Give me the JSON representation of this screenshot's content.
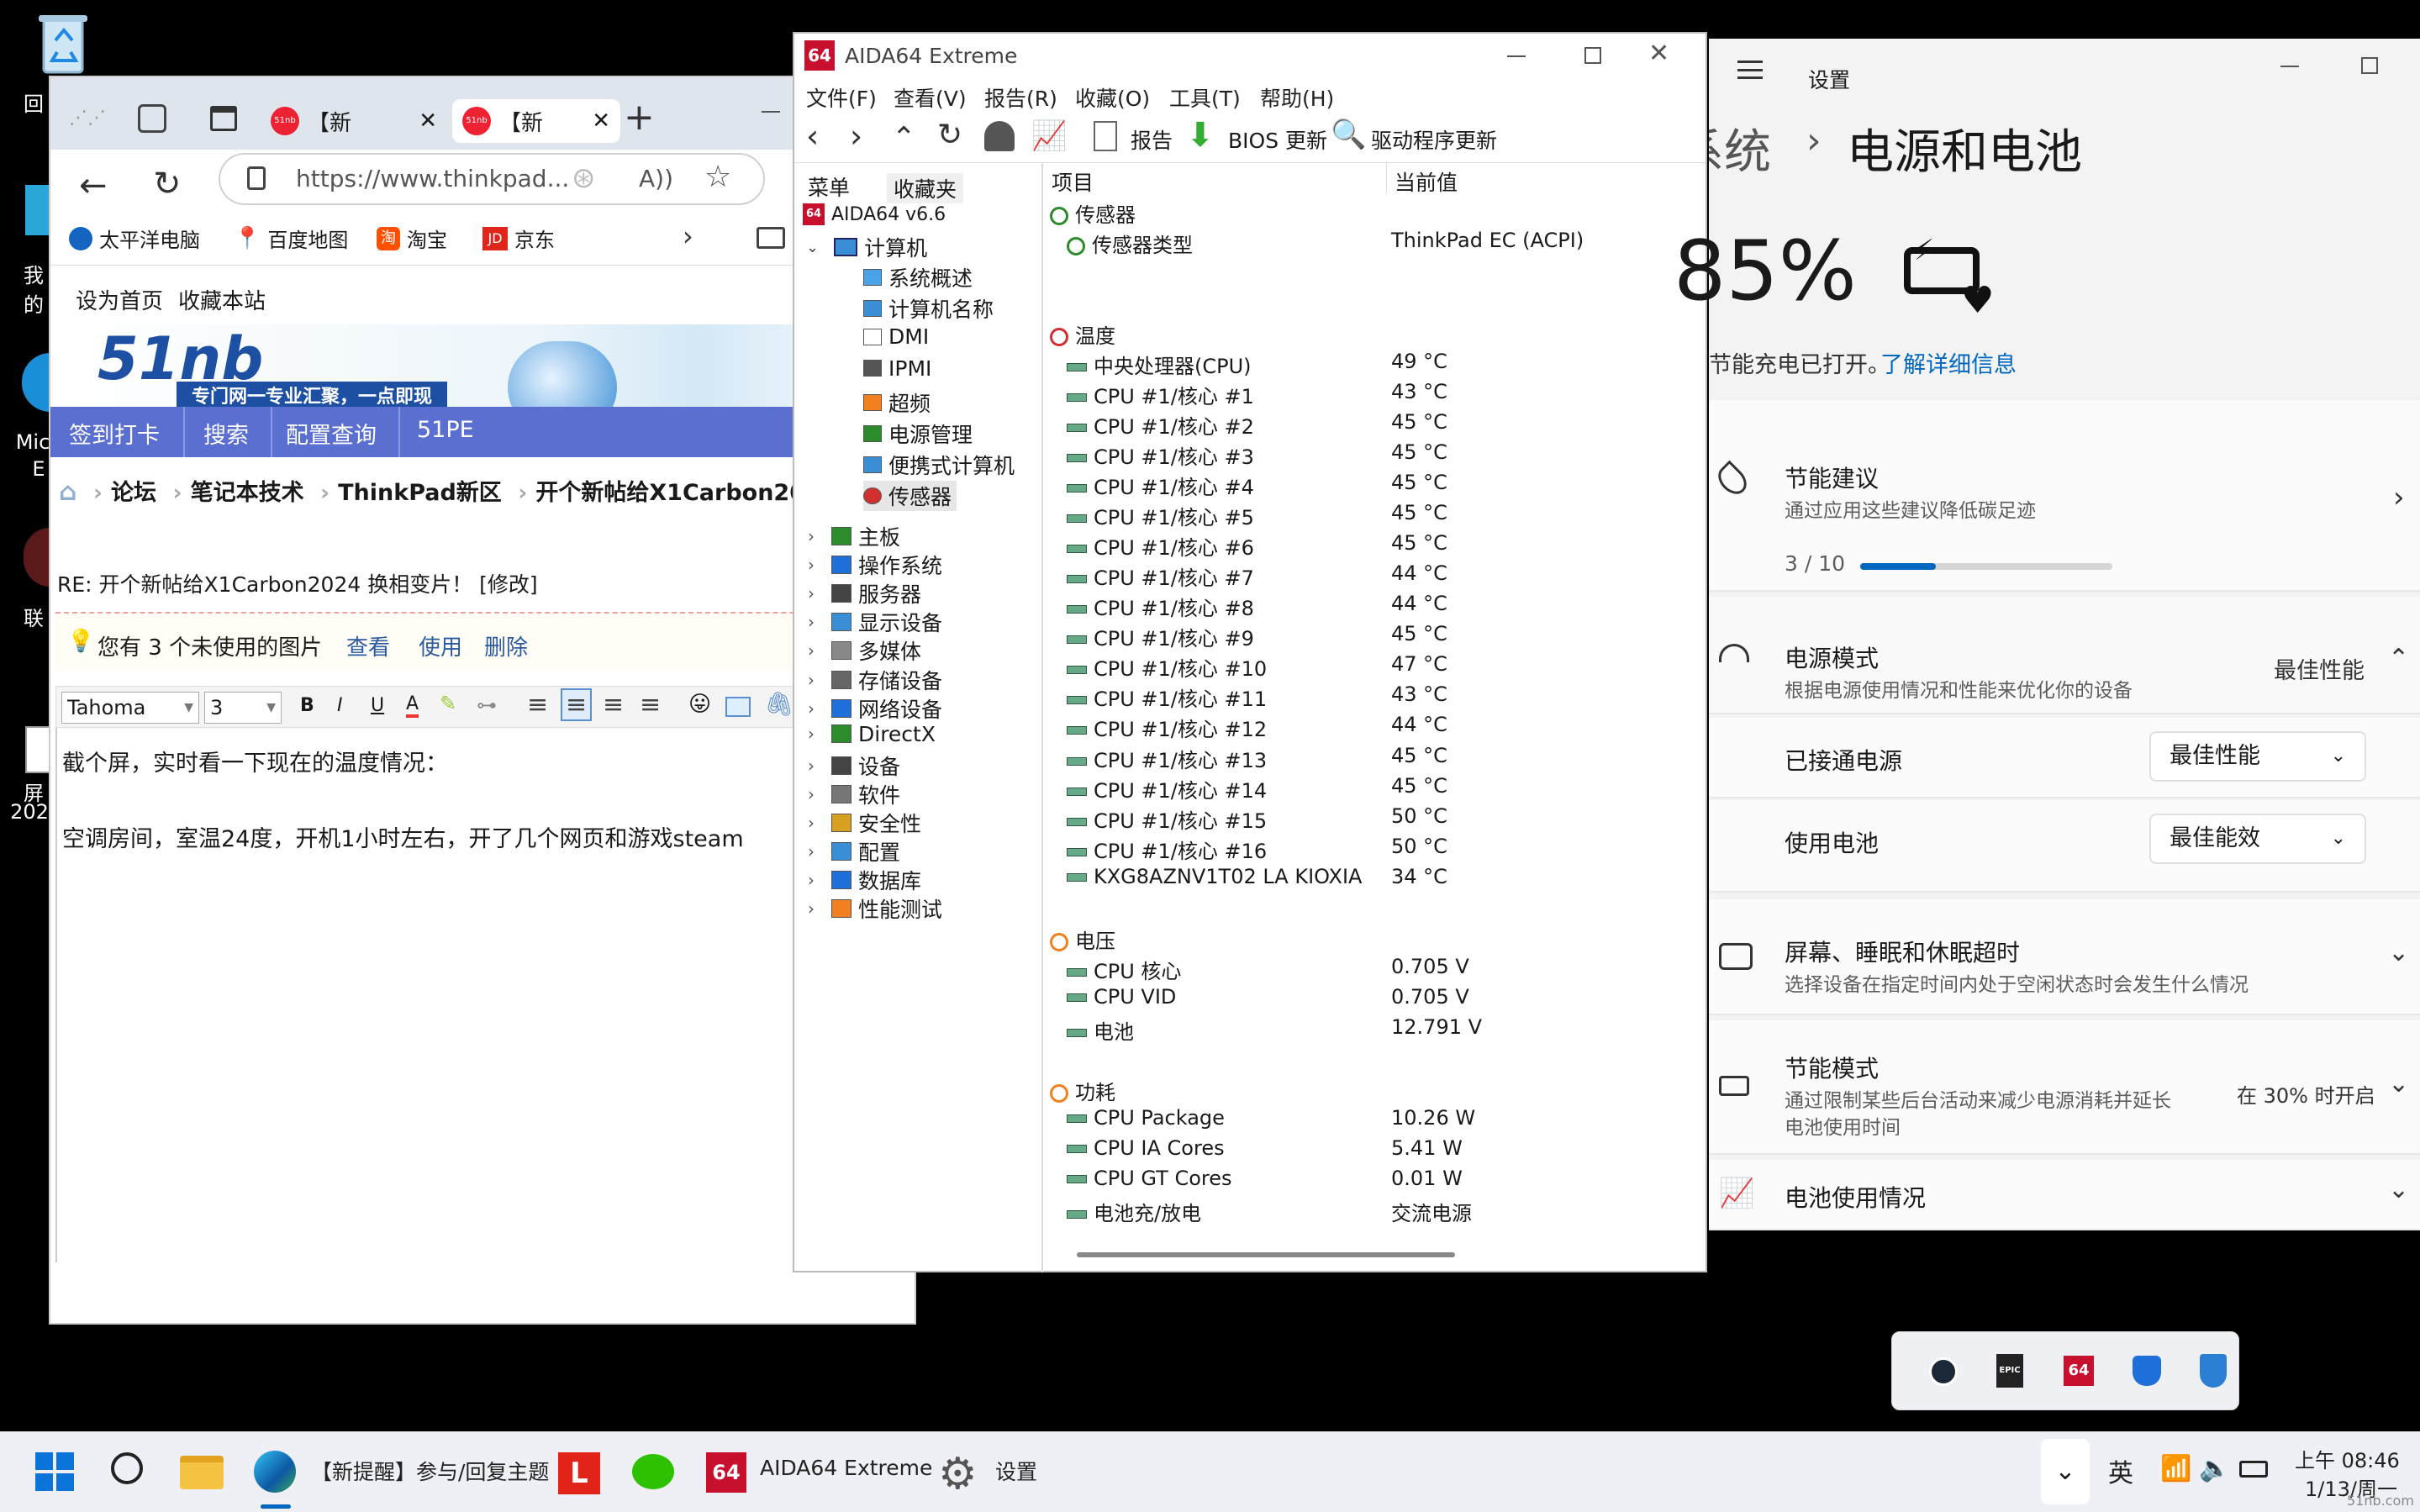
{
  "desktop": {
    "icon1": "回",
    "icon2": "我的",
    "icon3": "Mic",
    "icon3b": "E",
    "icon4": "联",
    "icon5": "屏",
    "icon5b": "202"
  },
  "browser": {
    "tabs": [
      {
        "badge": "51nb",
        "label": "【新"
      },
      {
        "badge": "51nb",
        "label": "【新"
      }
    ],
    "url": "https://www.thinkpad...",
    "favorites": [
      "太平洋电脑",
      "百度地图",
      "淘宝",
      "京东"
    ],
    "top_links": [
      "设为首页",
      "收藏本站"
    ],
    "logo_text": "51nb",
    "banner_slogan": "专门网一专业汇聚，一点即现",
    "nav": [
      "签到打卡",
      "搜索",
      "配置查询",
      "51PE"
    ],
    "breadcrumb": [
      "论坛",
      "笔记本技术",
      "ThinkPad新区",
      "开个新帖给X1Carbon20"
    ],
    "post_title": "RE: 开个新帖给X1Carbon2024 换相变片！ [修改]",
    "unused_notice": "您有 3 个未使用的图片",
    "notice_links": [
      "查看",
      "使用",
      "删除"
    ],
    "font_name": "Tahoma",
    "font_size": "3",
    "editor_line1": "截个屏，实时看一下现在的温度情况：",
    "editor_line2": "空调房间，室温24度，开机1小时左右，开了几个网页和游戏steam"
  },
  "aida": {
    "title": "AIDA64 Extreme",
    "logo": "64",
    "menu": [
      "文件(F)",
      "查看(V)",
      "报告(R)",
      "收藏(O)",
      "工具(T)",
      "帮助(H)"
    ],
    "toolbar": {
      "report": "报告",
      "bios": "BIOS 更新",
      "driver": "驱动程序更新"
    },
    "left_tabs": [
      "菜单",
      "收藏夹"
    ],
    "tree_root": "AIDA64 v6.6",
    "tree_computer": "计算机",
    "tree_children": [
      "系统概述",
      "计算机名称",
      "DMI",
      "IPMI",
      "超频",
      "电源管理",
      "便携式计算机",
      "传感器"
    ],
    "tree_top": [
      "主板",
      "操作系统",
      "服务器",
      "显示设备",
      "多媒体",
      "存储设备",
      "网络设备",
      "DirectX",
      "设备",
      "软件",
      "安全性",
      "配置",
      "数据库",
      "性能测试"
    ],
    "col_item": "项目",
    "col_value": "当前值",
    "sec_sensor": "传感器",
    "sensor_type_k": "传感器类型",
    "sensor_type_v": "ThinkPad EC  (ACPI)",
    "sec_temp": "温度",
    "temps": [
      [
        "中央处理器(CPU)",
        "49 °C"
      ],
      [
        "CPU #1/核心 #1",
        "43 °C"
      ],
      [
        "CPU #1/核心 #2",
        "45 °C"
      ],
      [
        "CPU #1/核心 #3",
        "45 °C"
      ],
      [
        "CPU #1/核心 #4",
        "45 °C"
      ],
      [
        "CPU #1/核心 #5",
        "45 °C"
      ],
      [
        "CPU #1/核心 #6",
        "45 °C"
      ],
      [
        "CPU #1/核心 #7",
        "44 °C"
      ],
      [
        "CPU #1/核心 #8",
        "44 °C"
      ],
      [
        "CPU #1/核心 #9",
        "45 °C"
      ],
      [
        "CPU #1/核心 #10",
        "47 °C"
      ],
      [
        "CPU #1/核心 #11",
        "43 °C"
      ],
      [
        "CPU #1/核心 #12",
        "44 °C"
      ],
      [
        "CPU #1/核心 #13",
        "45 °C"
      ],
      [
        "CPU #1/核心 #14",
        "45 °C"
      ],
      [
        "CPU #1/核心 #15",
        "50 °C"
      ],
      [
        "CPU #1/核心 #16",
        "50 °C"
      ],
      [
        "KXG8AZNV1T02 LA KIOXIA",
        "34 °C"
      ]
    ],
    "sec_volt": "电压",
    "volts": [
      [
        "CPU 核心",
        "0.705 V"
      ],
      [
        "CPU VID",
        "0.705 V"
      ],
      [
        "电池",
        "12.791 V"
      ]
    ],
    "sec_power": "功耗",
    "powers": [
      [
        "CPU Package",
        "10.26 W"
      ],
      [
        "CPU IA Cores",
        "5.41 W"
      ],
      [
        "CPU GT Cores",
        "0.01 W"
      ],
      [
        "电池充/放电",
        "交流电源"
      ]
    ]
  },
  "settings": {
    "app": "设置",
    "crumb1": "系统",
    "crumb2": "电源和电池",
    "battery_pct": "85%",
    "saver_line": "节能充电已打开。",
    "learn_more": "了解详细信息",
    "rec_title": "节能建议",
    "rec_sub": "通过应用这些建议降低碳足迹",
    "rec_progress": "3 / 10",
    "rec_fraction": 0.3,
    "mode_title": "电源模式",
    "mode_sub": "根据电源使用情况和性能来优化你的设备",
    "mode_value": "最佳性能",
    "plugged_label": "已接通电源",
    "plugged_value": "最佳性能",
    "battery_label": "使用电池",
    "battery_value": "最佳能效",
    "screen_title": "屏幕、睡眠和休眠超时",
    "screen_sub": "选择设备在指定时间内处于空闲状态时会发生什么情况",
    "eco_title": "节能模式",
    "eco_sub1": "通过限制某些后台活动来减少电源消耗并延长",
    "eco_sub2": "电池使用时间",
    "eco_value": "在 30% 时开启",
    "usage_title": "电池使用情况"
  },
  "tray_popup": [
    "steam",
    "EPIC",
    "64",
    "lenovo",
    "defender"
  ],
  "taskbar": {
    "edge_label": "【新提醒】参与/回复主题",
    "aida_label": "AIDA64 Extreme",
    "settings_label": "设置",
    "ime": "英",
    "time": "上午 08:46",
    "date": "1/13/周一",
    "watermark": "51nb.com"
  }
}
